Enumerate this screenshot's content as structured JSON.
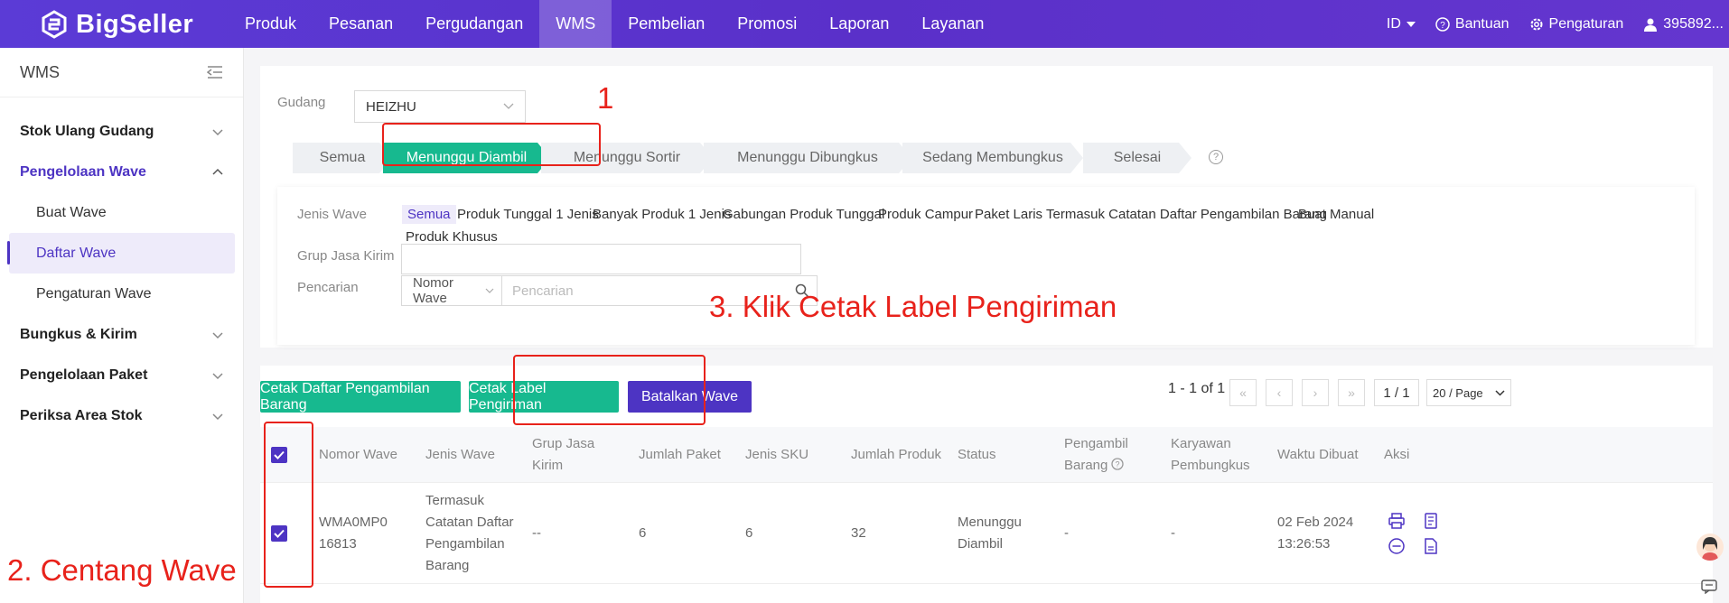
{
  "brand": "BigSeller",
  "nav": [
    "Produk",
    "Pesanan",
    "Pergudangan",
    "WMS",
    "Pembelian",
    "Promosi",
    "Laporan",
    "Layanan"
  ],
  "nav_active": "WMS",
  "top_right": {
    "lang": "ID",
    "help": "Bantuan",
    "settings": "Pengaturan",
    "user": "395892..."
  },
  "sidebar": {
    "title": "WMS",
    "groups": [
      {
        "label": "Stok Ulang Gudang"
      },
      {
        "label": "Pengelolaan Wave",
        "children": [
          "Buat Wave",
          "Daftar Wave",
          "Pengaturan Wave"
        ]
      },
      {
        "label": "Bungkus & Kirim"
      },
      {
        "label": "Pengelolaan Paket"
      },
      {
        "label": "Periksa Area Stok"
      }
    ]
  },
  "filter": {
    "gudang_label": "Gudang",
    "gudang_value": "HEIZHU",
    "steps": [
      "Semua",
      "Menunggu Diambil",
      "Menunggu Sortir",
      "Menunggu Dibungkus",
      "Sedang Membungkus",
      "Selesai"
    ],
    "jenis_label": "Jenis Wave",
    "jenis_options": [
      "Semua",
      "Produk Tunggal 1 Jenis",
      "Banyak Produk 1 Jenis",
      "Gabungan Produk Tunggal",
      "Produk Campur",
      "Paket Laris",
      "Termasuk Catatan Daftar Pengambilan Barang",
      "Buat Manual",
      "Produk Khusus"
    ],
    "grup_label": "Grup Jasa Kirim",
    "pencarian_label": "Pencarian",
    "search_type": "Nomor Wave",
    "search_placeholder": "Pencarian"
  },
  "actions": {
    "print_picklist": "Cetak Daftar Pengambilan Barang",
    "print_label": "Cetak Label Pengiriman",
    "cancel_wave": "Batalkan Wave"
  },
  "pager": {
    "range": "1 - 1 of 1",
    "page": "1 / 1",
    "per_page": "20 / Page"
  },
  "table": {
    "headers": [
      "Nomor Wave",
      "Jenis Wave",
      "Grup Jasa Kirim",
      "Jumlah Paket",
      "Jenis SKU",
      "Jumlah Produk",
      "Status",
      "Pengambil Barang",
      "Karyawan Pembungkus",
      "Waktu Dibuat",
      "Aksi"
    ],
    "rows": [
      {
        "nomor": "WMA0MP016813",
        "jenis": "Termasuk Catatan Daftar Pengambilan Barang",
        "grup": "--",
        "paket": "6",
        "sku": "6",
        "produk": "32",
        "status": "Menunggu Diambil",
        "pengambil": "-",
        "pembungkus": "-",
        "waktu": "02 Feb 2024 13:26:53"
      }
    ]
  },
  "annotations": {
    "step1": "1",
    "step2": "2. Centang Wave",
    "step3": "3. Klik Cetak Label Pengiriman"
  },
  "colors": {
    "brand_purple": "#5a30c9",
    "green": "#17b98f",
    "purple_btn": "#4d34c3",
    "annotation_red": "#e8221b"
  }
}
